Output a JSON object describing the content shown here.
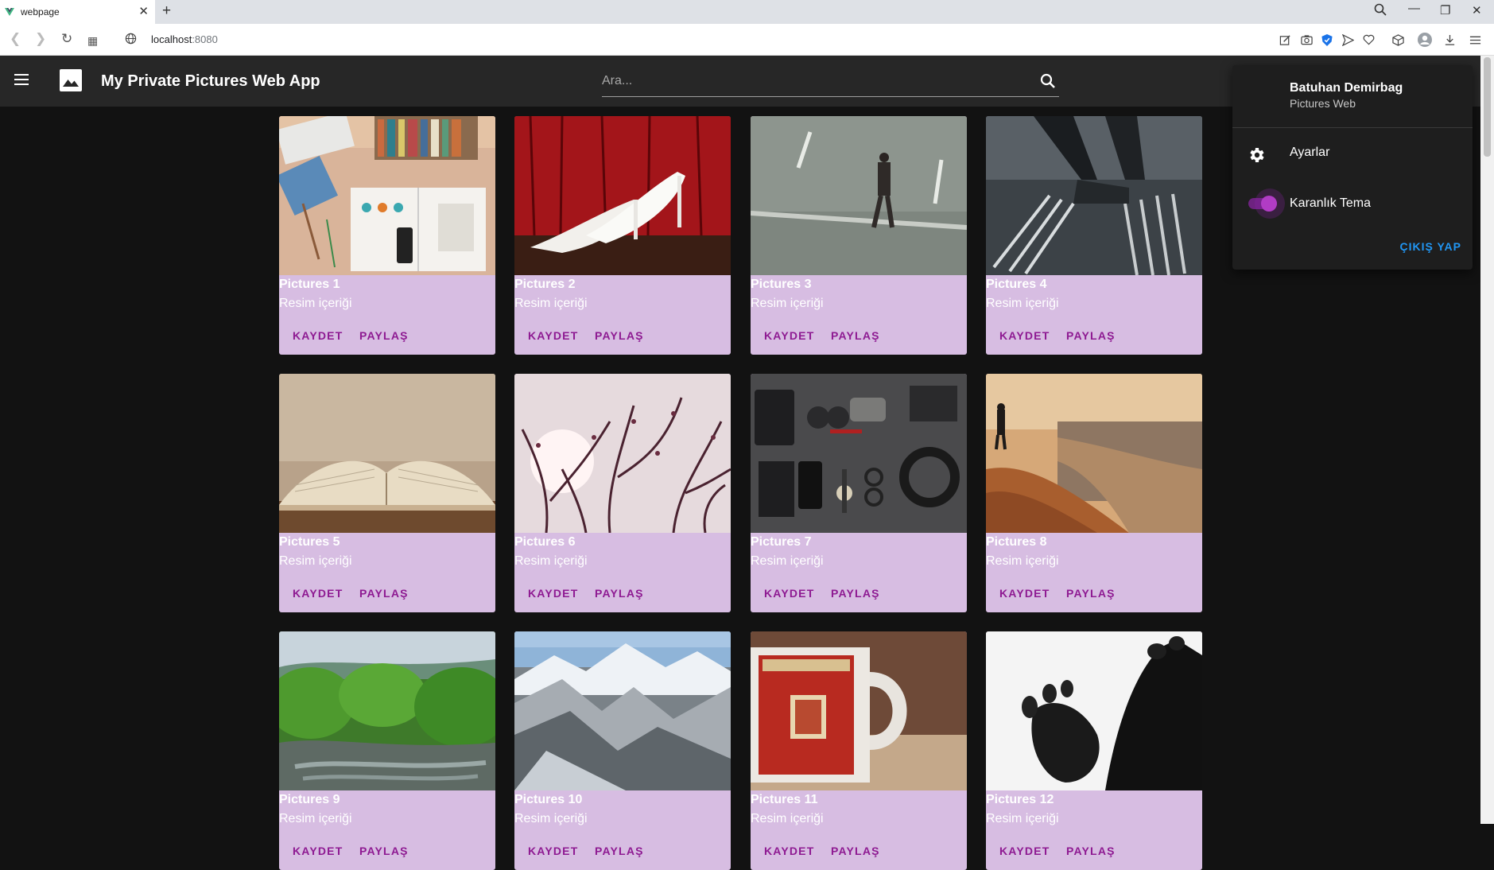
{
  "browser": {
    "tab_title": "webpage",
    "url_host": "localhost",
    "url_port": ":8080"
  },
  "app": {
    "title": "My Private Pictures Web App",
    "search_placeholder": "Ara..."
  },
  "cards": [
    {
      "title": "Pictures 1",
      "subtitle": "Resim içeriği",
      "save": "KAYDET",
      "share": "PAYLAŞ"
    },
    {
      "title": "Pictures 2",
      "subtitle": "Resim içeriği",
      "save": "KAYDET",
      "share": "PAYLAŞ"
    },
    {
      "title": "Pictures 3",
      "subtitle": "Resim içeriği",
      "save": "KAYDET",
      "share": "PAYLAŞ"
    },
    {
      "title": "Pictures 4",
      "subtitle": "Resim içeriği",
      "save": "KAYDET",
      "share": "PAYLAŞ"
    },
    {
      "title": "Pictures 5",
      "subtitle": "Resim içeriği",
      "save": "KAYDET",
      "share": "PAYLAŞ"
    },
    {
      "title": "Pictures 6",
      "subtitle": "Resim içeriği",
      "save": "KAYDET",
      "share": "PAYLAŞ"
    },
    {
      "title": "Pictures 7",
      "subtitle": "Resim içeriği",
      "save": "KAYDET",
      "share": "PAYLAŞ"
    },
    {
      "title": "Pictures 8",
      "subtitle": "Resim içeriği",
      "save": "KAYDET",
      "share": "PAYLAŞ"
    },
    {
      "title": "Pictures 9",
      "subtitle": "Resim içeriği",
      "save": "KAYDET",
      "share": "PAYLAŞ"
    },
    {
      "title": "Pictures 10",
      "subtitle": "Resim içeriği",
      "save": "KAYDET",
      "share": "PAYLAŞ"
    },
    {
      "title": "Pictures 11",
      "subtitle": "Resim içeriği",
      "save": "KAYDET",
      "share": "PAYLAŞ"
    },
    {
      "title": "Pictures 12",
      "subtitle": "Resim içeriği",
      "save": "KAYDET",
      "share": "PAYLAŞ"
    }
  ],
  "profile_menu": {
    "name": "Batuhan Demirbag",
    "subtitle": "Pictures Web",
    "settings_label": "Ayarlar",
    "dark_theme_label": "Karanlık Tema",
    "dark_theme_on": true,
    "logout_label": "ÇIKIŞ YAP"
  },
  "colors": {
    "card_bg": "#d7bde2",
    "button_text": "#8e1a92",
    "accent": "#8e24aa",
    "logout": "#2196f3"
  }
}
